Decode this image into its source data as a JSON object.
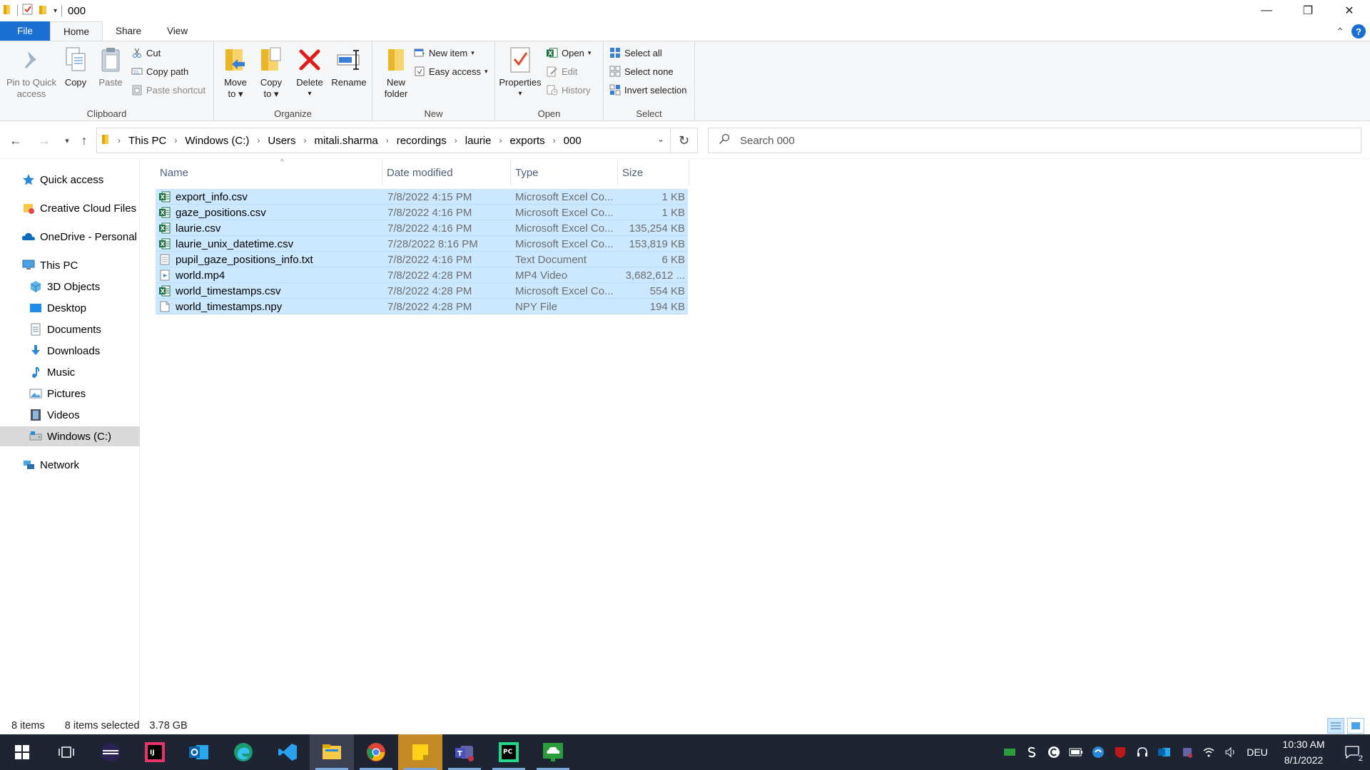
{
  "window": {
    "title": "000",
    "controls": {
      "minimize": "—",
      "restore": "❐",
      "close": "✕"
    }
  },
  "tabs": [
    {
      "label": "File"
    },
    {
      "label": "Home"
    },
    {
      "label": "Share"
    },
    {
      "label": "View"
    }
  ],
  "ribbon": {
    "clipboard": {
      "label": "Clipboard",
      "pin": "Pin to Quick access",
      "pin_line1": "Pin to Quick",
      "pin_line2": "access",
      "copy": "Copy",
      "paste": "Paste",
      "cut": "Cut",
      "copy_path": "Copy path",
      "paste_shortcut": "Paste shortcut"
    },
    "organize": {
      "label": "Organize",
      "move_line1": "Move",
      "move_line2": "to",
      "copy_line1": "Copy",
      "copy_line2": "to",
      "delete": "Delete",
      "rename": "Rename"
    },
    "new": {
      "label": "New",
      "new_folder_line1": "New",
      "new_folder_line2": "folder",
      "new_item": "New item",
      "easy_access": "Easy access"
    },
    "open": {
      "label": "Open",
      "properties": "Properties",
      "open": "Open",
      "edit": "Edit",
      "history": "History"
    },
    "select": {
      "label": "Select",
      "select_all": "Select all",
      "select_none": "Select none",
      "invert": "Invert selection"
    }
  },
  "address": {
    "breadcrumbs": [
      "This PC",
      "Windows (C:)",
      "Users",
      "mitali.sharma",
      "recordings",
      "laurie",
      "exports",
      "000"
    ],
    "search_placeholder": "Search 000"
  },
  "sidebar": {
    "items": [
      {
        "label": "Quick access",
        "icon": "star-icon"
      },
      {
        "label": "Creative Cloud Files",
        "icon": "creative-cloud-icon"
      },
      {
        "label": "OneDrive - Personal",
        "icon": "onedrive-icon"
      },
      {
        "label": "This PC",
        "icon": "pc-icon"
      },
      {
        "label": "3D Objects",
        "icon": "3d-objects-icon"
      },
      {
        "label": "Desktop",
        "icon": "desktop-icon"
      },
      {
        "label": "Documents",
        "icon": "documents-icon"
      },
      {
        "label": "Downloads",
        "icon": "downloads-icon"
      },
      {
        "label": "Music",
        "icon": "music-icon"
      },
      {
        "label": "Pictures",
        "icon": "pictures-icon"
      },
      {
        "label": "Videos",
        "icon": "videos-icon"
      },
      {
        "label": "Windows (C:)",
        "icon": "drive-icon",
        "selected": true
      },
      {
        "label": "Network",
        "icon": "network-icon"
      }
    ]
  },
  "files": {
    "columns": [
      "Name",
      "Date modified",
      "Type",
      "Size"
    ],
    "rows": [
      {
        "name": "export_info.csv",
        "date": "7/8/2022 4:15 PM",
        "type": "Microsoft Excel Co...",
        "size": "1 KB",
        "icon": "excel"
      },
      {
        "name": "gaze_positions.csv",
        "date": "7/8/2022 4:16 PM",
        "type": "Microsoft Excel Co...",
        "size": "1 KB",
        "icon": "excel"
      },
      {
        "name": "laurie.csv",
        "date": "7/8/2022 4:16 PM",
        "type": "Microsoft Excel Co...",
        "size": "135,254 KB",
        "icon": "excel"
      },
      {
        "name": "laurie_unix_datetime.csv",
        "date": "7/28/2022 8:16 PM",
        "type": "Microsoft Excel Co...",
        "size": "153,819 KB",
        "icon": "excel"
      },
      {
        "name": "pupil_gaze_positions_info.txt",
        "date": "7/8/2022 4:16 PM",
        "type": "Text Document",
        "size": "6 KB",
        "icon": "text"
      },
      {
        "name": "world.mp4",
        "date": "7/8/2022 4:28 PM",
        "type": "MP4 Video",
        "size": "3,682,612 ...",
        "icon": "video"
      },
      {
        "name": "world_timestamps.csv",
        "date": "7/8/2022 4:28 PM",
        "type": "Microsoft Excel Co...",
        "size": "554 KB",
        "icon": "excel"
      },
      {
        "name": "world_timestamps.npy",
        "date": "7/8/2022 4:28 PM",
        "type": "NPY File",
        "size": "194 KB",
        "icon": "blank"
      }
    ]
  },
  "status": {
    "count": "8 items",
    "selected": "8 items selected",
    "size": "3.78 GB"
  },
  "taskbar": {
    "apps": [
      "start-icon",
      "task-view-icon",
      "eclipse-icon",
      "intellij-icon",
      "outlook-icon",
      "edge-icon",
      "vscode-icon",
      "file-explorer-icon",
      "chrome-icon",
      "sticky-notes-icon",
      "teams-icon",
      "pycharm-icon",
      "cloud-app-icon"
    ],
    "language": "DEU",
    "time": "10:30 AM",
    "date": "8/1/2022",
    "notifications": "2"
  },
  "colors": {
    "selection": "#cce8ff",
    "accent": "#1a6fd1",
    "taskbar": "#1f2433"
  }
}
